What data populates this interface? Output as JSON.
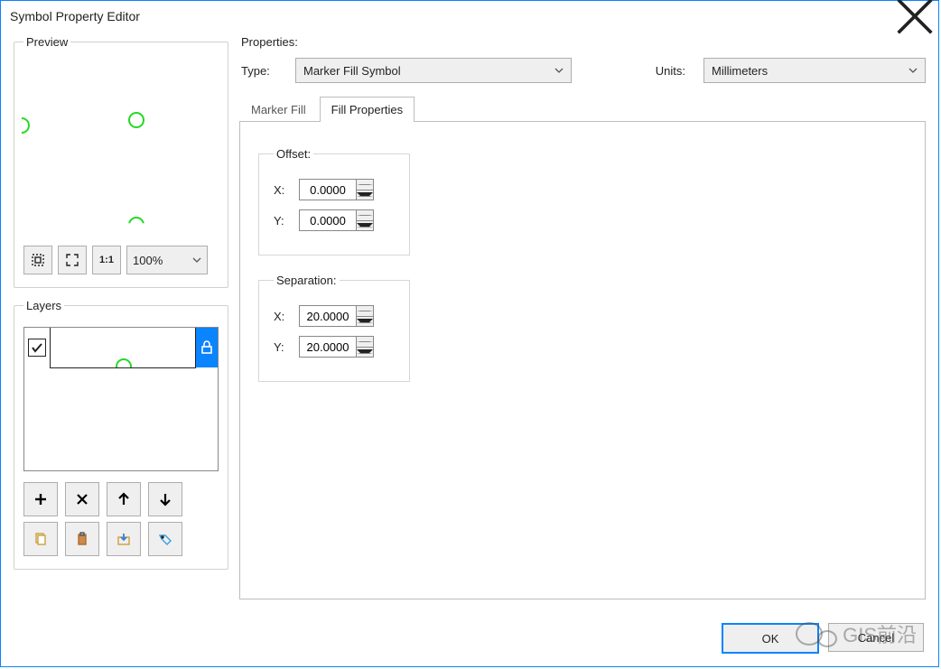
{
  "window": {
    "title": "Symbol Property Editor"
  },
  "preview": {
    "legend": "Preview",
    "zoom": "100%"
  },
  "layers": {
    "legend": "Layers"
  },
  "properties": {
    "legend": "Properties:",
    "type_label": "Type:",
    "type_value": "Marker Fill Symbol",
    "units_label": "Units:",
    "units_value": "Millimeters",
    "tabs": {
      "marker_fill": "Marker Fill",
      "fill_properties": "Fill Properties"
    },
    "offset": {
      "legend": "Offset:",
      "x_label": "X:",
      "x": "0.0000",
      "y_label": "Y:",
      "y": "0.0000"
    },
    "separation": {
      "legend": "Separation:",
      "x_label": "X:",
      "x": "20.0000",
      "y_label": "Y:",
      "y": "20.0000"
    }
  },
  "buttons": {
    "ok": "OK",
    "cancel": "Cancel"
  },
  "watermark": "GIS前沿"
}
